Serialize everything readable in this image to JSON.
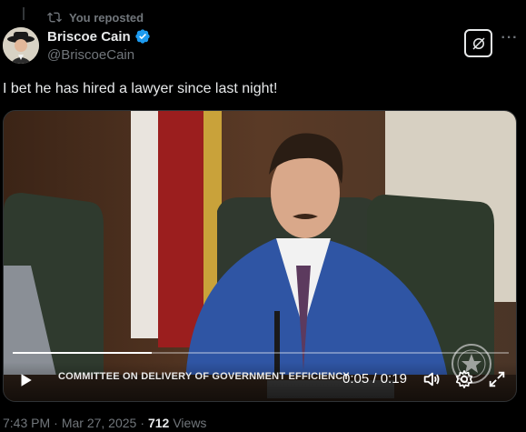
{
  "repost": {
    "label": "You reposted"
  },
  "author": {
    "display_name": "Briscoe Cain",
    "handle": "@BriscoeCain"
  },
  "tweet": {
    "text": "I bet he has hired a lawyer since last night!"
  },
  "video": {
    "lower_third": "COMMITTEE ON DELIVERY OF GOVERNMENT EFFICIENCY",
    "current_time": "0:05",
    "duration": "0:19",
    "progress": 0.28,
    "time_separator": " / "
  },
  "meta": {
    "time": "7:43 PM",
    "dot1": "·",
    "date": "Mar 27, 2025",
    "dot2": "·",
    "views": "712",
    "views_label": "Views"
  },
  "colors": {
    "verified": "#1d9bf0",
    "muted": "#71767b",
    "text": "#e7e9ea"
  }
}
